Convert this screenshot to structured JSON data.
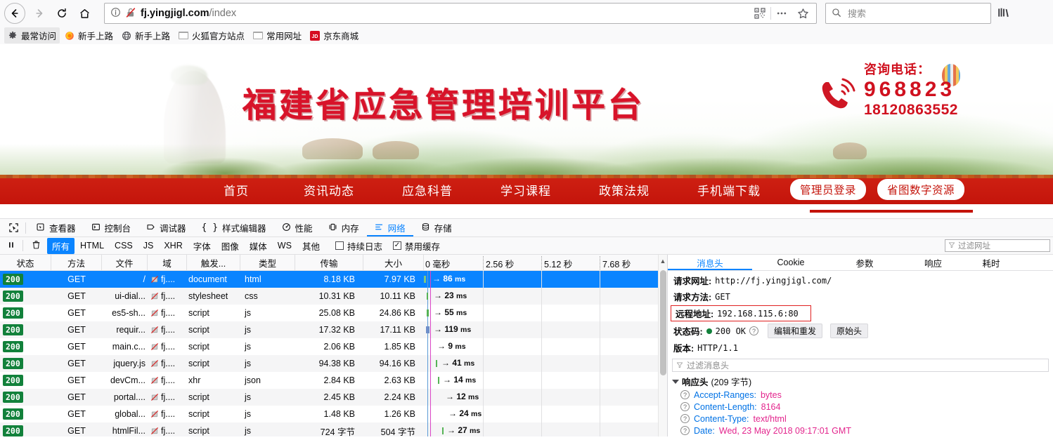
{
  "browser": {
    "url": {
      "scheme": "",
      "host": "fj.yingjigl.com",
      "path": "/index"
    },
    "search_placeholder": "搜索",
    "bookmarks": [
      {
        "label": "最常访问",
        "icon": "gear-icon"
      },
      {
        "label": "新手上路",
        "icon": "firefox-icon"
      },
      {
        "label": "新手上路",
        "icon": "globe-icon"
      },
      {
        "label": "火狐官方站点",
        "icon": "folder-icon"
      },
      {
        "label": "常用网址",
        "icon": "folder-icon"
      },
      {
        "label": "京东商城",
        "icon": "jd-icon"
      }
    ]
  },
  "site": {
    "title": "福建省应急管理培训平台",
    "phone_label": "咨询电话：",
    "phone_main": "968823",
    "phone_sub": "18120863552",
    "nav": [
      "首页",
      "资讯动态",
      "应急科普",
      "学习课程",
      "政策法规",
      "手机端下载"
    ],
    "buttons": [
      "管理员登录",
      "省图数字资源"
    ],
    "accent_red": "#c4140b"
  },
  "devtools": {
    "tabs": [
      {
        "label": "查看器",
        "icon": "inspector-icon",
        "active": false
      },
      {
        "label": "控制台",
        "icon": "console-icon",
        "active": false
      },
      {
        "label": "调试器",
        "icon": "debugger-icon",
        "active": false
      },
      {
        "label": "样式编辑器",
        "icon": "style-editor-icon",
        "active": false
      },
      {
        "label": "性能",
        "icon": "performance-icon",
        "active": false
      },
      {
        "label": "内存",
        "icon": "memory-icon",
        "active": false
      },
      {
        "label": "网络",
        "icon": "network-icon",
        "active": true
      },
      {
        "label": "存储",
        "icon": "storage-icon",
        "active": false
      }
    ],
    "filters": [
      "所有",
      "HTML",
      "CSS",
      "JS",
      "XHR",
      "字体",
      "图像",
      "媒体",
      "WS",
      "其他"
    ],
    "active_filter": "所有",
    "persist_logs": {
      "label": "持续日志",
      "checked": false
    },
    "disable_cache": {
      "label": "禁用缓存",
      "checked": true
    },
    "filter_input_placeholder": "过滤网址",
    "columns": [
      "状态",
      "方法",
      "文件",
      "域",
      "触发...",
      "类型",
      "传输",
      "大小"
    ],
    "timeline_ticks": [
      "0 毫秒",
      "2.56 秒",
      "5.12 秒",
      "7.68 秒"
    ],
    "requests": [
      {
        "status": "200",
        "method": "GET",
        "file": "/",
        "domain": "fj....",
        "type": "document",
        "subtype": "html",
        "transfer": "8.18 KB",
        "size": "7.97 KB",
        "time": "86",
        "selected": true,
        "barwidth": 3,
        "baroffset": 0,
        "arrowoffset": 12
      },
      {
        "status": "200",
        "method": "GET",
        "file": "ui-dial...",
        "domain": "fj....",
        "type": "stylesheet",
        "subtype": "css",
        "transfer": "10.31 KB",
        "size": "10.11 KB",
        "time": "23",
        "selected": false,
        "barwidth": 2,
        "baroffset": 4,
        "arrowoffset": 14
      },
      {
        "status": "200",
        "method": "GET",
        "file": "es5-sh...",
        "domain": "fj....",
        "type": "script",
        "subtype": "js",
        "transfer": "25.08 KB",
        "size": "24.86 KB",
        "time": "55",
        "selected": false,
        "barwidth": 3,
        "baroffset": 4,
        "arrowoffset": 14
      },
      {
        "status": "200",
        "method": "GET",
        "file": "requir...",
        "domain": "fj....",
        "type": "script",
        "subtype": "js",
        "transfer": "17.32 KB",
        "size": "17.11 KB",
        "time": "119",
        "selected": false,
        "barwidth": 5,
        "baroffset": 3,
        "arrowoffset": 14
      },
      {
        "status": "200",
        "method": "GET",
        "file": "main.c...",
        "domain": "fj....",
        "type": "script",
        "subtype": "js",
        "transfer": "2.06 KB",
        "size": "1.85 KB",
        "time": "9",
        "selected": false,
        "barwidth": 0,
        "baroffset": 0,
        "arrowoffset": 19
      },
      {
        "status": "200",
        "method": "GET",
        "file": "jquery.js",
        "domain": "fj....",
        "type": "script",
        "subtype": "js",
        "transfer": "94.38 KB",
        "size": "94.16 KB",
        "time": "41",
        "selected": false,
        "barwidth": 2,
        "baroffset": 17,
        "arrowoffset": 25
      },
      {
        "status": "200",
        "method": "GET",
        "file": "devCm...",
        "domain": "fj....",
        "type": "xhr",
        "subtype": "json",
        "transfer": "2.84 KB",
        "size": "2.63 KB",
        "time": "14",
        "selected": false,
        "barwidth": 2,
        "baroffset": 20,
        "arrowoffset": 27
      },
      {
        "status": "200",
        "method": "GET",
        "file": "portal....",
        "domain": "fj....",
        "type": "script",
        "subtype": "js",
        "transfer": "2.45 KB",
        "size": "2.24 KB",
        "time": "12",
        "selected": false,
        "barwidth": 0,
        "baroffset": 0,
        "arrowoffset": 31
      },
      {
        "status": "200",
        "method": "GET",
        "file": "global...",
        "domain": "fj....",
        "type": "script",
        "subtype": "js",
        "transfer": "1.48 KB",
        "size": "1.26 KB",
        "time": "24",
        "selected": false,
        "barwidth": 0,
        "baroffset": 0,
        "arrowoffset": 35
      },
      {
        "status": "200",
        "method": "GET",
        "file": "htmlFil...",
        "domain": "fj....",
        "type": "script",
        "subtype": "js",
        "transfer": "724 字节",
        "size": "504 字节",
        "time": "27",
        "selected": false,
        "barwidth": 2,
        "baroffset": 26,
        "arrowoffset": 33
      }
    ],
    "detail": {
      "tabs": [
        "消息头",
        "Cookie",
        "参数",
        "响应",
        "耗时"
      ],
      "active_tab": "消息头",
      "request_url": {
        "label": "请求网址:",
        "value": "http://fj.yingjigl.com/"
      },
      "request_method": {
        "label": "请求方法:",
        "value": "GET"
      },
      "remote_address": {
        "label": "远程地址:",
        "value": "192.168.115.6:80"
      },
      "status_code": {
        "label": "状态码:",
        "value": "200 OK"
      },
      "edit_resend": "编辑和重发",
      "raw_headers": "原始头",
      "version": {
        "label": "版本:",
        "value": "HTTP/1.1"
      },
      "header_filter_placeholder": "过滤消息头",
      "response_headers_title": "响应头",
      "response_headers_count": "(209 字节)",
      "response_headers": [
        {
          "name": "Accept-Ranges",
          "value": "bytes"
        },
        {
          "name": "Content-Length",
          "value": "8164"
        },
        {
          "name": "Content-Type",
          "value": "text/html"
        },
        {
          "name": "Date",
          "value": "Wed, 23 May 2018 09:17:01 GMT"
        }
      ]
    }
  }
}
